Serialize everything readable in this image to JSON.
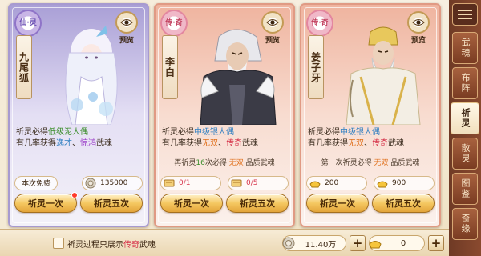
{
  "cards": [
    {
      "badge": "仙·灵",
      "name": "九尾狐",
      "preview_label": "预览",
      "desc_line1": {
        "prefix": "祈灵必得",
        "highlight": "低级泥人偶"
      },
      "desc_line2": {
        "prefix": "有几率获得",
        "h1": "逸才",
        "sep": "、",
        "h2": "惊鸿",
        "suffix": "武魂"
      },
      "free_label": "本次免费",
      "cost_value": "135000",
      "btn_once": "祈灵一次",
      "btn_five": "祈灵五次"
    },
    {
      "badge": "传·奇",
      "name": "李白",
      "preview_label": "预览",
      "desc_line1": {
        "prefix": "祈灵必得",
        "highlight": "中级银人偶"
      },
      "desc_line2": {
        "prefix": "有几率获得",
        "h1": "无双",
        "sep": "、",
        "h2": "传奇",
        "suffix": "武魂"
      },
      "info": {
        "prefix": "再祈灵",
        "count": "16",
        "mid": "次必得",
        "quality": "无双",
        "suffix": "品质武魂"
      },
      "cost_once": "0/1",
      "cost_five": "0/5",
      "btn_once": "祈灵一次",
      "btn_five": "祈灵五次"
    },
    {
      "badge": "传·奇",
      "name": "姜子牙",
      "preview_label": "预览",
      "desc_line1": {
        "prefix": "祈灵必得",
        "highlight": "中级银人偶"
      },
      "desc_line2": {
        "prefix": "有几率获得",
        "h1": "无双",
        "sep": "、",
        "h2": "传奇",
        "suffix": "武魂"
      },
      "info": {
        "prefix": "第一次祈灵必得",
        "quality": "无双",
        "suffix": "品质武魂"
      },
      "cost_once": "200",
      "cost_five": "900",
      "btn_once": "祈灵一次",
      "btn_five": "祈灵五次"
    }
  ],
  "sidebar": {
    "tabs": [
      "武魂",
      "布阵",
      "祈灵",
      "散灵",
      "图鉴",
      "奇缘"
    ],
    "active_index": 2
  },
  "bottom": {
    "label_prefix": "祈灵过程只展示",
    "label_highlight": "传奇",
    "label_suffix": "武魂",
    "silver_value": "11.40万",
    "gold_value": "0"
  },
  "colors": {
    "green": "#3a8d2a",
    "blue": "#2f7fc2",
    "purple": "#9b3fc9",
    "orange": "#e0701c",
    "red": "#d6334a"
  }
}
